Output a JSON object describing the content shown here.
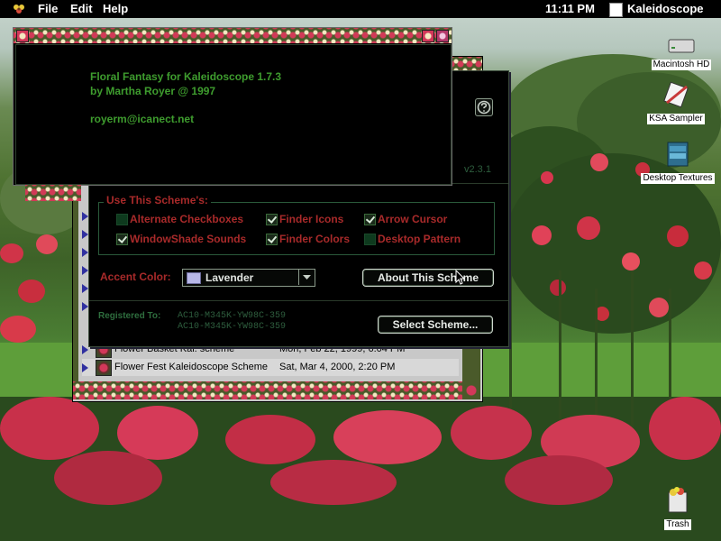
{
  "menubar": {
    "items": [
      "File",
      "Edit",
      "Help"
    ],
    "clock": "11:11 PM",
    "app_name": "Kaleidoscope"
  },
  "desktop_icons": [
    {
      "label": "Macintosh HD",
      "icon": "hard-disk-icon"
    },
    {
      "label": "KSA Sampler",
      "icon": "ksa-sampler-icon"
    },
    {
      "label": "Desktop Textures",
      "icon": "desktop-textures-icon"
    },
    {
      "label": "Trash",
      "icon": "trash-icon"
    }
  ],
  "about": {
    "line1": "Floral Fantasy for Kaleidoscope 1.7.3",
    "line2": "by Martha Royer @ 1997",
    "email": "royerm@icanect.net"
  },
  "control_panel": {
    "version": "v2.3.1",
    "group_label": "Use This Scheme's:",
    "options": [
      {
        "label": "Alternate Checkboxes",
        "checked": false
      },
      {
        "label": "Finder Icons",
        "checked": true
      },
      {
        "label": "Arrow Cursor",
        "checked": true
      },
      {
        "label": "WindowShade Sounds",
        "checked": true
      },
      {
        "label": "Finder Colors",
        "checked": true
      },
      {
        "label": "Desktop Pattern",
        "checked": false
      }
    ],
    "accent_label": "Accent Color:",
    "accent_value": "Lavender",
    "about_button": "About This Scheme",
    "registered_label": "Registered To:",
    "registration_codes": [
      "AC10-M345K-YW98C-359",
      "AC10-M345K-YW98C-359"
    ],
    "select_button": "Select Scheme..."
  },
  "file_list": [
    {
      "name": "Flower Basket Kal. scheme",
      "date": "Mon, Feb 22, 1999, 6:04 PM"
    },
    {
      "name": "Flower Fest Kaleidoscope Scheme",
      "date": "Sat, Mar 4, 2000, 2:20 PM"
    }
  ],
  "colors": {
    "accent_green": "#1e8c3a",
    "option_red": "#a82a2a",
    "lavender": "#b8b8e8"
  }
}
